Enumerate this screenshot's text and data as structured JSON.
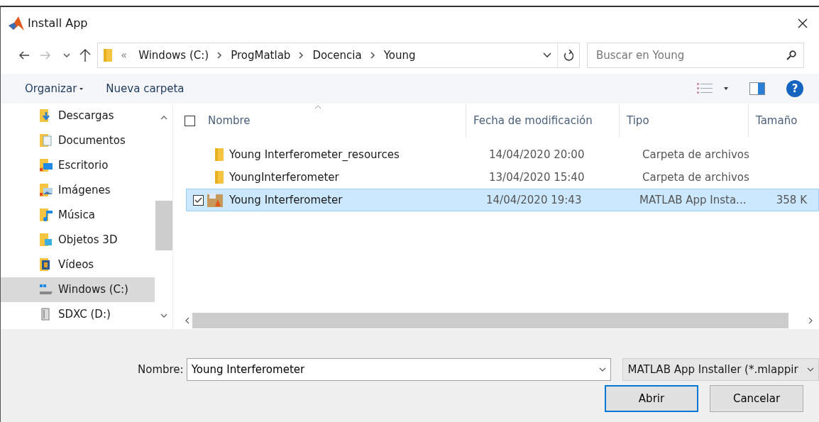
{
  "window": {
    "title": "Install App"
  },
  "address": {
    "overflow": "«",
    "path": [
      "Windows (C:)",
      "ProgMatlab",
      "Docencia",
      "Young"
    ]
  },
  "search": {
    "placeholder": "Buscar en Young"
  },
  "toolbar": {
    "organize": "Organizar",
    "new_folder": "Nueva carpeta",
    "help": "?"
  },
  "sidebar": {
    "items": [
      {
        "label": "Descargas",
        "kind": "downloads",
        "selected": false
      },
      {
        "label": "Documentos",
        "kind": "documents",
        "selected": false
      },
      {
        "label": "Escritorio",
        "kind": "desktop",
        "selected": false
      },
      {
        "label": "Imágenes",
        "kind": "pictures",
        "selected": false
      },
      {
        "label": "Música",
        "kind": "music",
        "selected": false
      },
      {
        "label": "Objetos 3D",
        "kind": "objects3d",
        "selected": false
      },
      {
        "label": "Vídeos",
        "kind": "videos",
        "selected": false
      },
      {
        "label": "Windows (C:)",
        "kind": "drive",
        "selected": true
      },
      {
        "label": "SDXC (D:)",
        "kind": "card",
        "selected": false
      }
    ]
  },
  "table": {
    "select_all_checked": false,
    "columns": [
      "Nombre",
      "Fecha de modificación",
      "Tipo",
      "Tamaño"
    ],
    "rows": [
      {
        "name": "Young Interferometer_resources",
        "date": "14/04/2020 20:00",
        "type": "Carpeta de archivos",
        "kind": "folder",
        "selected": false,
        "checked": false
      },
      {
        "name": "YoungInterferometer",
        "date": "13/04/2020 15:40",
        "type": "Carpeta de archivos",
        "kind": "folder",
        "selected": false,
        "checked": false
      },
      {
        "name": "Young Interferometer",
        "date": "14/04/2020 19:43",
        "type": "MATLAB App Insta...",
        "size": "358 K",
        "kind": "app",
        "selected": true,
        "checked": true
      }
    ]
  },
  "footer": {
    "name_label": "Nombre:",
    "name_value": "Young Interferometer",
    "filter": "MATLAB App Installer (*.mlappir",
    "buttons": [
      {
        "label": "Abrir",
        "default": true
      },
      {
        "label": "Cancelar",
        "default": false
      }
    ]
  }
}
